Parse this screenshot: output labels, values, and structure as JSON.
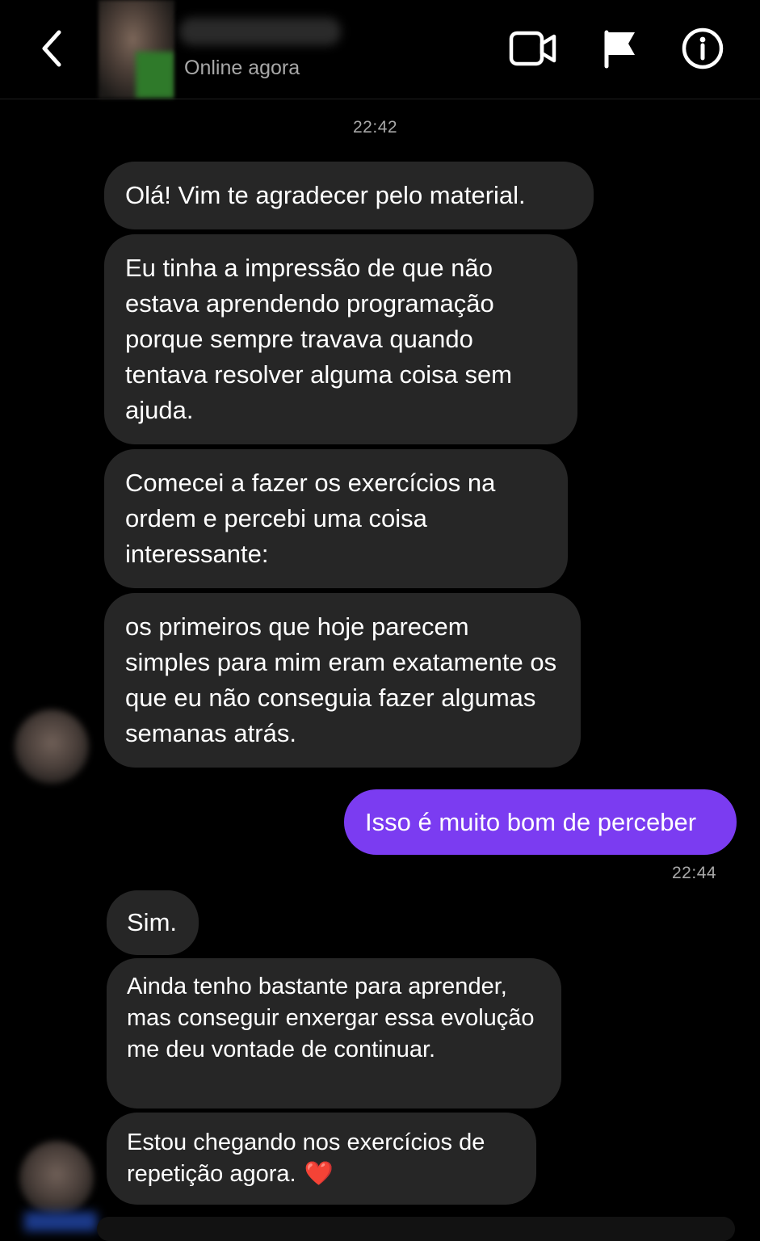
{
  "header": {
    "status": "Online agora",
    "icons": [
      "back-chevron-icon",
      "video-call-icon",
      "flag-icon",
      "info-icon"
    ]
  },
  "colors": {
    "background": "#000000",
    "received_bubble": "#262626",
    "sent_bubble": "#7b3cf1",
    "secondary_text": "#a8a8a8",
    "heart": "#e0203a"
  },
  "thread": {
    "time_1": "22:42",
    "received_1": [
      "Olá! Vim te agradecer pelo material.",
      "Eu tinha a impressão de que não estava aprendendo programação porque sempre travava quando tentava resolver alguma coisa sem ajuda.",
      "Comecei a fazer os exercícios na ordem e percebi uma coisa interessante:",
      "os primeiros que hoje parecem simples para mim eram exatamente os que eu não conseguia fazer algumas semanas atrás."
    ],
    "sent_1": "Isso é muito bom de perceber",
    "time_2": "22:44",
    "received_2": [
      "Sim.",
      "Ainda tenho bastante para aprender, mas conseguir enxergar essa evolução me deu vontade de continuar.",
      "Estou chegando nos exercícios de repetição agora."
    ],
    "emoji": "❤️"
  }
}
